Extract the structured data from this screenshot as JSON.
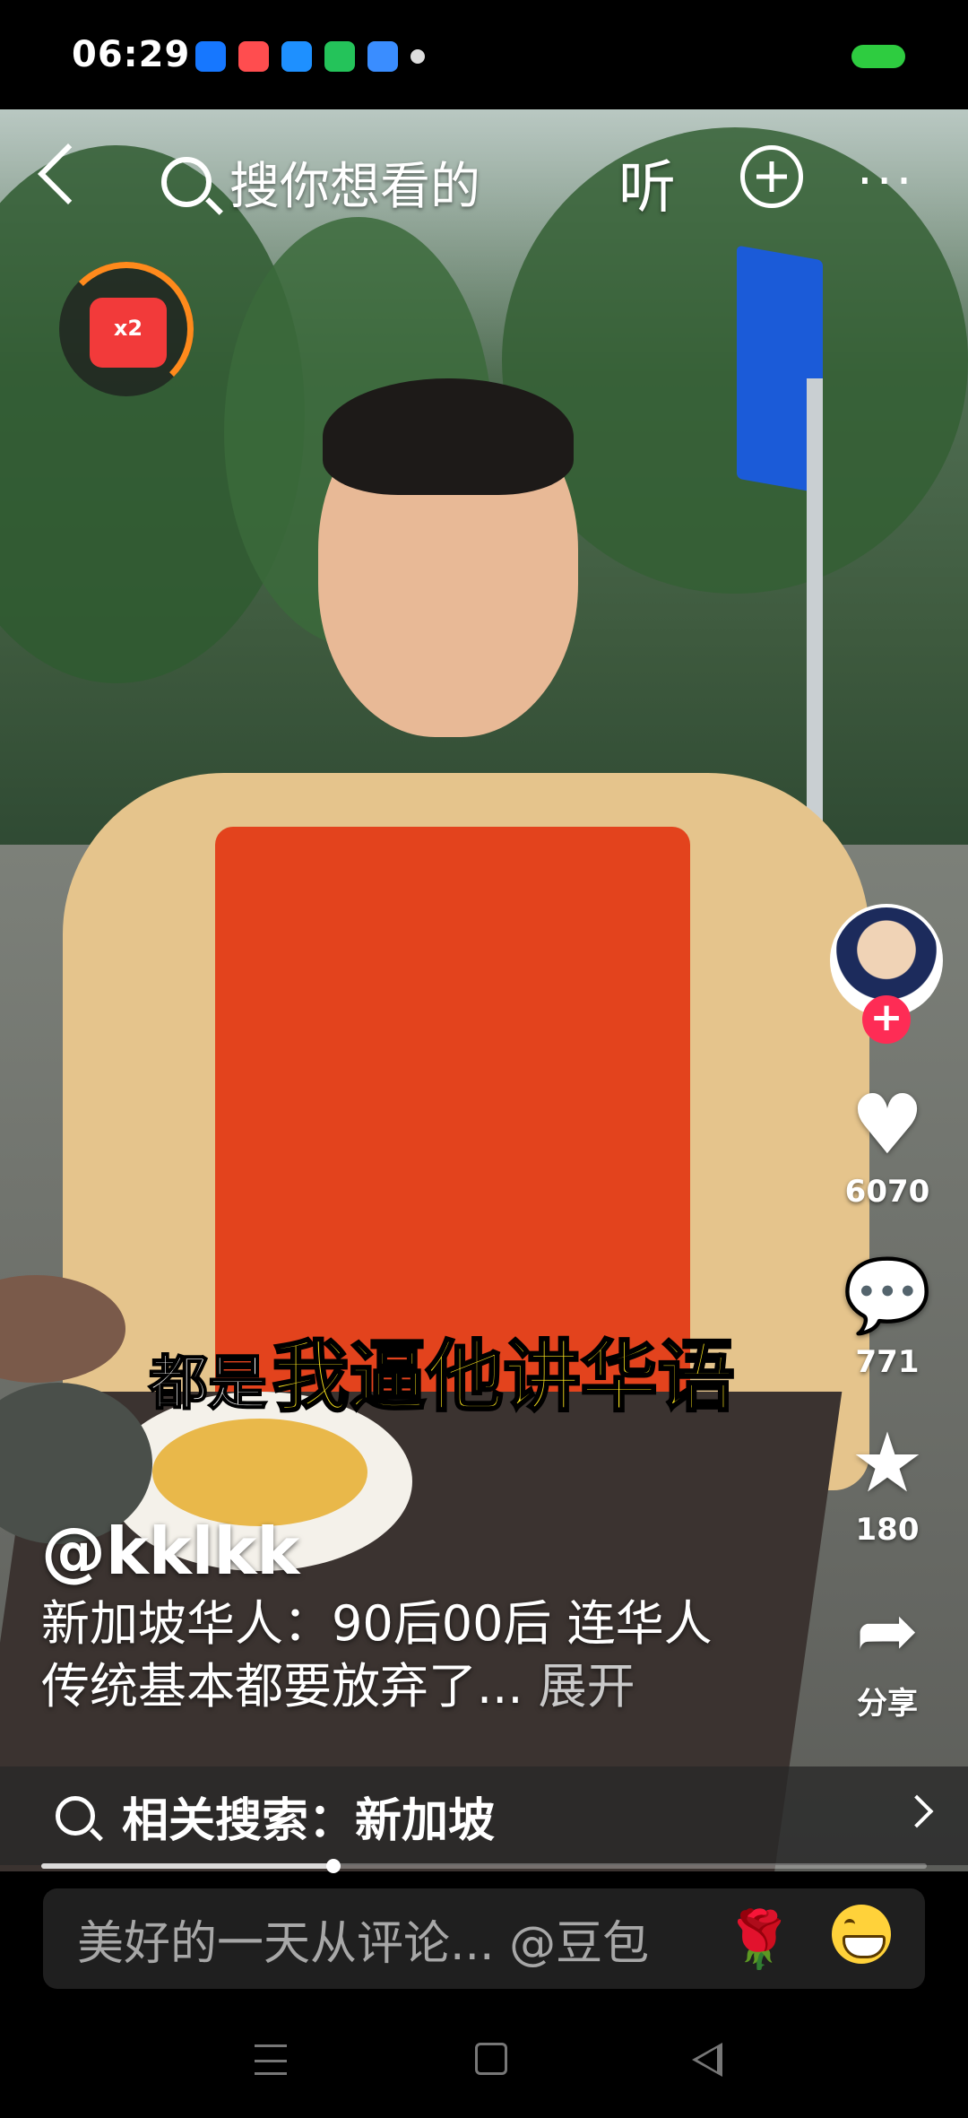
{
  "status_bar": {
    "time": "06:29",
    "app_icons": [
      {
        "name": "alipay-icon",
        "color": "#1677ff",
        "glyph": "支"
      },
      {
        "name": "video-icon",
        "color": "#ff4d4f",
        "glyph": "▶"
      },
      {
        "name": "browser-icon",
        "color": "#1e90ff",
        "glyph": "◆"
      },
      {
        "name": "wallet-icon",
        "color": "#24c35a",
        "glyph": "▯"
      },
      {
        "name": "weather-icon",
        "color": "#3a8dff",
        "glyph": "☁"
      }
    ]
  },
  "top_bar": {
    "search_placeholder": "搜你想看的",
    "listen_label": "听",
    "more_label": "···"
  },
  "red_packet": {
    "multiplier_label": "x2"
  },
  "actions": {
    "likes": "6070",
    "comments": "771",
    "favorites": "180",
    "share_label": "分享",
    "follow_label": "+"
  },
  "subtitle": {
    "plain": "都是",
    "highlight": "我逼他讲华语"
  },
  "post": {
    "author": "@kklkk",
    "caption": "新加坡华人：90后00后 连华人传统基本都要放弃了...",
    "expand_label": "展开"
  },
  "related_search": {
    "text": "相关搜索：新加坡"
  },
  "playback": {
    "progress_fraction": 0.33
  },
  "comment_bar": {
    "placeholder": "美好的一天从评论... @豆包",
    "rose_glyph": "🌹"
  },
  "colors": {
    "accent": "#fe2c55",
    "subtitle_highlight": "#f8e21c",
    "apron": "#e3431d"
  }
}
